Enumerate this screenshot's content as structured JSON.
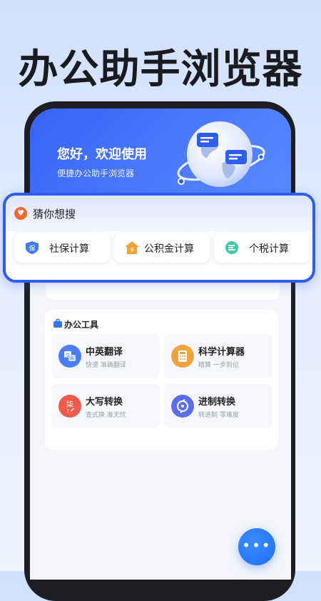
{
  "headline": "办公助手浏览器",
  "hero": {
    "greeting": "您好，欢迎使用",
    "subtitle": "便捷办公助手浏览器"
  },
  "guess": {
    "title": "猜你想搜",
    "items": [
      {
        "label": "社保计算",
        "icon": "shield-icon"
      },
      {
        "label": "公积金计算",
        "icon": "house-icon"
      },
      {
        "label": "个税计算",
        "icon": "tax-icon"
      }
    ]
  },
  "tools": {
    "title": "办公工具",
    "items": [
      {
        "name": "中英翻译",
        "desc": "快速 准确翻译",
        "icon": "translate-icon",
        "color": "#4b7df5"
      },
      {
        "name": "科学计算器",
        "desc": "精算 一步到位",
        "icon": "calculator-icon",
        "color": "#f2a23a"
      },
      {
        "name": "大写转换",
        "desc": "查式换 准无忧",
        "icon": "currency-convert-icon",
        "color": "#ef5a4c"
      },
      {
        "name": "进制转换",
        "desc": "转进制 零难度",
        "icon": "base-convert-icon",
        "color": "#5a6ff0"
      }
    ]
  },
  "fab": {
    "icon": "more-icon",
    "label": "•••"
  },
  "colors": {
    "accent": "#2f5df2",
    "hero": "#4d7cff"
  }
}
